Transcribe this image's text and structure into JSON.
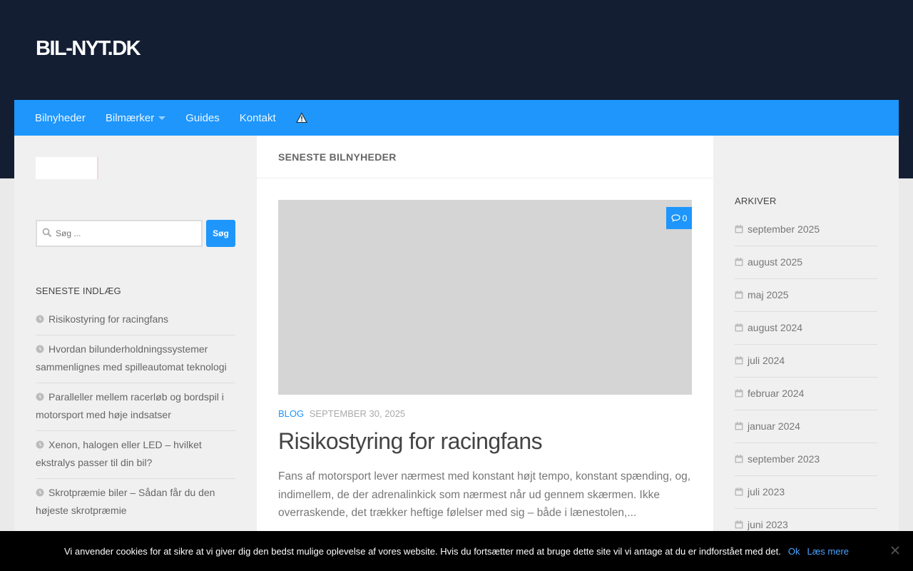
{
  "header": {
    "site_title": "BIL-NYT.DK"
  },
  "nav": {
    "items": [
      "Bilnyheder",
      "Bilmærker",
      "Guides",
      "Kontakt"
    ],
    "warning_icon": "warning-icon"
  },
  "sidebar_left": {
    "search": {
      "placeholder": "Søg ...",
      "button_label": "Søg"
    },
    "recent": {
      "title": "SENESTE INDLÆG",
      "items": [
        "Risikostyring for racingfans",
        "Hvordan bilunderholdningssystemer sammenlignes med spilleautomat teknologi",
        "Paralleller mellem racerløb og bordspil i motorsport med høje indsatser",
        "Xenon, halogen eller LED – hvilket ekstralys passer til din bil?",
        "Skrotpræmie biler – Sådan får du den højeste skrotpræmie"
      ]
    }
  },
  "main": {
    "heading": "SENESTE BILNYHEDER",
    "post": {
      "comments": "0",
      "category": "BLOG",
      "date": "SEPTEMBER 30, 2025",
      "title": "Risikostyring for racingfans",
      "excerpt": "Fans af motorsport lever nærmest med konstant højt tempo, konstant spænding, og, indimellem, de der adrenalinkick som nærmest når ud gennem skærmen. Ikke overraskende, det trækker heftige følelser med sig – både i lænestolen,..."
    }
  },
  "sidebar_right": {
    "archive_title": "ARKIVER",
    "archives": [
      "september 2025",
      "august 2025",
      "maj 2025",
      "august 2024",
      "juli 2024",
      "februar 2024",
      "januar 2024",
      "september 2023",
      "juli 2023",
      "juni 2023"
    ]
  },
  "cookie": {
    "text": "Vi anvender cookies for at sikre at vi giver dig den bedst mulige oplevelse af vores website. Hvis du fortsætter med at bruge dette site vil vi antage at du er indforstået med det.",
    "ok": "Ok",
    "read_more": "Læs mere"
  },
  "colors": {
    "accent": "#1e96fc",
    "header_bg": "#141e33"
  }
}
